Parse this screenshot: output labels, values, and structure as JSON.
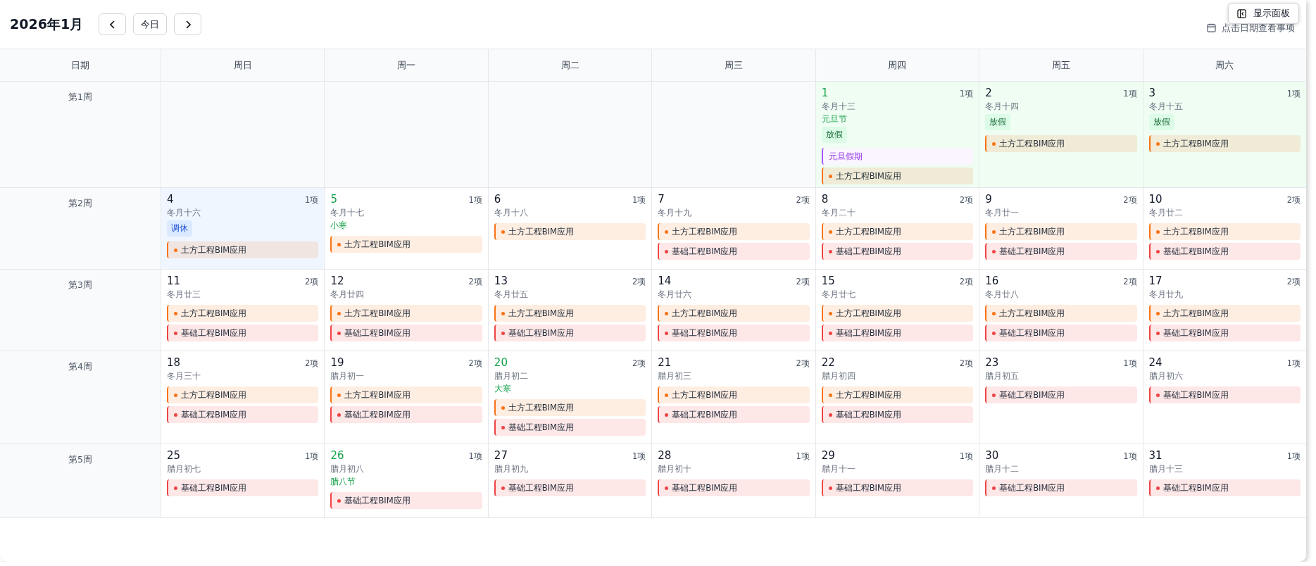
{
  "header": {
    "title": "2026年1月",
    "today_button": "今日",
    "hint": "点击日期查看事项"
  },
  "panel_button": "显示面板",
  "columns": [
    "日期",
    "周日",
    "周一",
    "周二",
    "周三",
    "周四",
    "周五",
    "周六"
  ],
  "weeks": [
    {
      "label": "第1周",
      "days": [
        {
          "kind": "empty"
        },
        {
          "kind": "empty"
        },
        {
          "kind": "empty"
        },
        {
          "kind": "empty"
        },
        {
          "kind": "day",
          "date": "1",
          "count": "1项",
          "lunar": "冬月十三",
          "festival": "元旦节",
          "color": "#effdf3",
          "tag": {
            "text": "放假",
            "kind": "off"
          },
          "events": [
            {
              "title": "元旦假期",
              "kind": "holiday"
            },
            {
              "title": "土方工程BIM应用",
              "kind": "earth"
            }
          ]
        },
        {
          "kind": "day",
          "date": "2",
          "count": "1项",
          "lunar": "冬月十四",
          "color": "#effdf3",
          "tag": {
            "text": "放假",
            "kind": "off"
          },
          "events": [
            {
              "title": "土方工程BIM应用",
              "kind": "earth"
            }
          ]
        },
        {
          "kind": "day",
          "date": "3",
          "count": "1项",
          "lunar": "冬月十五",
          "color": "#effdf3",
          "tag": {
            "text": "放假",
            "kind": "off"
          },
          "events": [
            {
              "title": "土方工程BIM应用",
              "kind": "earth"
            }
          ]
        }
      ]
    },
    {
      "label": "第2周",
      "days": [
        {
          "kind": "day",
          "date": "4",
          "count": "1项",
          "lunar": "冬月十六",
          "color": "#eff6ff",
          "tag": {
            "text": "调休",
            "kind": "work"
          },
          "events": [
            {
              "title": "土方工程BIM应用",
              "kind": "earth"
            }
          ]
        },
        {
          "kind": "day",
          "date": "5",
          "count": "1项",
          "lunar": "冬月十七",
          "festival": "小寒",
          "events": [
            {
              "title": "土方工程BIM应用",
              "kind": "earth"
            }
          ]
        },
        {
          "kind": "day",
          "date": "6",
          "count": "1项",
          "lunar": "冬月十八",
          "events": [
            {
              "title": "土方工程BIM应用",
              "kind": "earth"
            }
          ]
        },
        {
          "kind": "day",
          "date": "7",
          "count": "2项",
          "lunar": "冬月十九",
          "events": [
            {
              "title": "土方工程BIM应用",
              "kind": "earth"
            },
            {
              "title": "基础工程BIM应用",
              "kind": "foundation"
            }
          ]
        },
        {
          "kind": "day",
          "date": "8",
          "count": "2项",
          "lunar": "冬月二十",
          "events": [
            {
              "title": "土方工程BIM应用",
              "kind": "earth"
            },
            {
              "title": "基础工程BIM应用",
              "kind": "foundation"
            }
          ]
        },
        {
          "kind": "day",
          "date": "9",
          "count": "2项",
          "lunar": "冬月廿一",
          "events": [
            {
              "title": "土方工程BIM应用",
              "kind": "earth"
            },
            {
              "title": "基础工程BIM应用",
              "kind": "foundation"
            }
          ]
        },
        {
          "kind": "day",
          "date": "10",
          "count": "2项",
          "lunar": "冬月廿二",
          "events": [
            {
              "title": "土方工程BIM应用",
              "kind": "earth"
            },
            {
              "title": "基础工程BIM应用",
              "kind": "foundation"
            }
          ]
        }
      ]
    },
    {
      "label": "第3周",
      "days": [
        {
          "kind": "day",
          "date": "11",
          "count": "2项",
          "lunar": "冬月廿三",
          "events": [
            {
              "title": "土方工程BIM应用",
              "kind": "earth"
            },
            {
              "title": "基础工程BIM应用",
              "kind": "foundation"
            }
          ]
        },
        {
          "kind": "day",
          "date": "12",
          "count": "2项",
          "lunar": "冬月廿四",
          "events": [
            {
              "title": "土方工程BIM应用",
              "kind": "earth"
            },
            {
              "title": "基础工程BIM应用",
              "kind": "foundation"
            }
          ]
        },
        {
          "kind": "day",
          "date": "13",
          "count": "2项",
          "lunar": "冬月廿五",
          "events": [
            {
              "title": "土方工程BIM应用",
              "kind": "earth"
            },
            {
              "title": "基础工程BIM应用",
              "kind": "foundation"
            }
          ]
        },
        {
          "kind": "day",
          "date": "14",
          "count": "2项",
          "lunar": "冬月廿六",
          "events": [
            {
              "title": "土方工程BIM应用",
              "kind": "earth"
            },
            {
              "title": "基础工程BIM应用",
              "kind": "foundation"
            }
          ]
        },
        {
          "kind": "day",
          "date": "15",
          "count": "2项",
          "lunar": "冬月廿七",
          "events": [
            {
              "title": "土方工程BIM应用",
              "kind": "earth"
            },
            {
              "title": "基础工程BIM应用",
              "kind": "foundation"
            }
          ]
        },
        {
          "kind": "day",
          "date": "16",
          "count": "2项",
          "lunar": "冬月廿八",
          "events": [
            {
              "title": "土方工程BIM应用",
              "kind": "earth"
            },
            {
              "title": "基础工程BIM应用",
              "kind": "foundation"
            }
          ]
        },
        {
          "kind": "day",
          "date": "17",
          "count": "2项",
          "lunar": "冬月廿九",
          "events": [
            {
              "title": "土方工程BIM应用",
              "kind": "earth"
            },
            {
              "title": "基础工程BIM应用",
              "kind": "foundation"
            }
          ]
        }
      ]
    },
    {
      "label": "第4周",
      "days": [
        {
          "kind": "day",
          "date": "18",
          "count": "2项",
          "lunar": "冬月三十",
          "events": [
            {
              "title": "土方工程BIM应用",
              "kind": "earth"
            },
            {
              "title": "基础工程BIM应用",
              "kind": "foundation"
            }
          ]
        },
        {
          "kind": "day",
          "date": "19",
          "count": "2项",
          "lunar": "腊月初一",
          "events": [
            {
              "title": "土方工程BIM应用",
              "kind": "earth"
            },
            {
              "title": "基础工程BIM应用",
              "kind": "foundation"
            }
          ]
        },
        {
          "kind": "day",
          "date": "20",
          "count": "2项",
          "lunar": "腊月初二",
          "festival": "大寒",
          "events": [
            {
              "title": "土方工程BIM应用",
              "kind": "earth"
            },
            {
              "title": "基础工程BIM应用",
              "kind": "foundation"
            }
          ]
        },
        {
          "kind": "day",
          "date": "21",
          "count": "2项",
          "lunar": "腊月初三",
          "events": [
            {
              "title": "土方工程BIM应用",
              "kind": "earth"
            },
            {
              "title": "基础工程BIM应用",
              "kind": "foundation"
            }
          ]
        },
        {
          "kind": "day",
          "date": "22",
          "count": "2项",
          "lunar": "腊月初四",
          "events": [
            {
              "title": "土方工程BIM应用",
              "kind": "earth"
            },
            {
              "title": "基础工程BIM应用",
              "kind": "foundation"
            }
          ]
        },
        {
          "kind": "day",
          "date": "23",
          "count": "1项",
          "lunar": "腊月初五",
          "events": [
            {
              "title": "基础工程BIM应用",
              "kind": "foundation"
            }
          ]
        },
        {
          "kind": "day",
          "date": "24",
          "count": "1项",
          "lunar": "腊月初六",
          "events": [
            {
              "title": "基础工程BIM应用",
              "kind": "foundation"
            }
          ]
        }
      ]
    },
    {
      "label": "第5周",
      "days": [
        {
          "kind": "day",
          "date": "25",
          "count": "1项",
          "lunar": "腊月初七",
          "events": [
            {
              "title": "基础工程BIM应用",
              "kind": "foundation"
            }
          ]
        },
        {
          "kind": "day",
          "date": "26",
          "count": "1项",
          "lunar": "腊月初八",
          "festival": "腊八节",
          "events": [
            {
              "title": "基础工程BIM应用",
              "kind": "foundation"
            }
          ]
        },
        {
          "kind": "day",
          "date": "27",
          "count": "1项",
          "lunar": "腊月初九",
          "events": [
            {
              "title": "基础工程BIM应用",
              "kind": "foundation"
            }
          ]
        },
        {
          "kind": "day",
          "date": "28",
          "count": "1项",
          "lunar": "腊月初十",
          "events": [
            {
              "title": "基础工程BIM应用",
              "kind": "foundation"
            }
          ]
        },
        {
          "kind": "day",
          "date": "29",
          "count": "1项",
          "lunar": "腊月十一",
          "events": [
            {
              "title": "基础工程BIM应用",
              "kind": "foundation"
            }
          ]
        },
        {
          "kind": "day",
          "date": "30",
          "count": "1项",
          "lunar": "腊月十二",
          "events": [
            {
              "title": "基础工程BIM应用",
              "kind": "foundation"
            }
          ]
        },
        {
          "kind": "day",
          "date": "31",
          "count": "1项",
          "lunar": "腊月十三",
          "events": [
            {
              "title": "基础工程BIM应用",
              "kind": "foundation"
            }
          ]
        }
      ]
    }
  ]
}
